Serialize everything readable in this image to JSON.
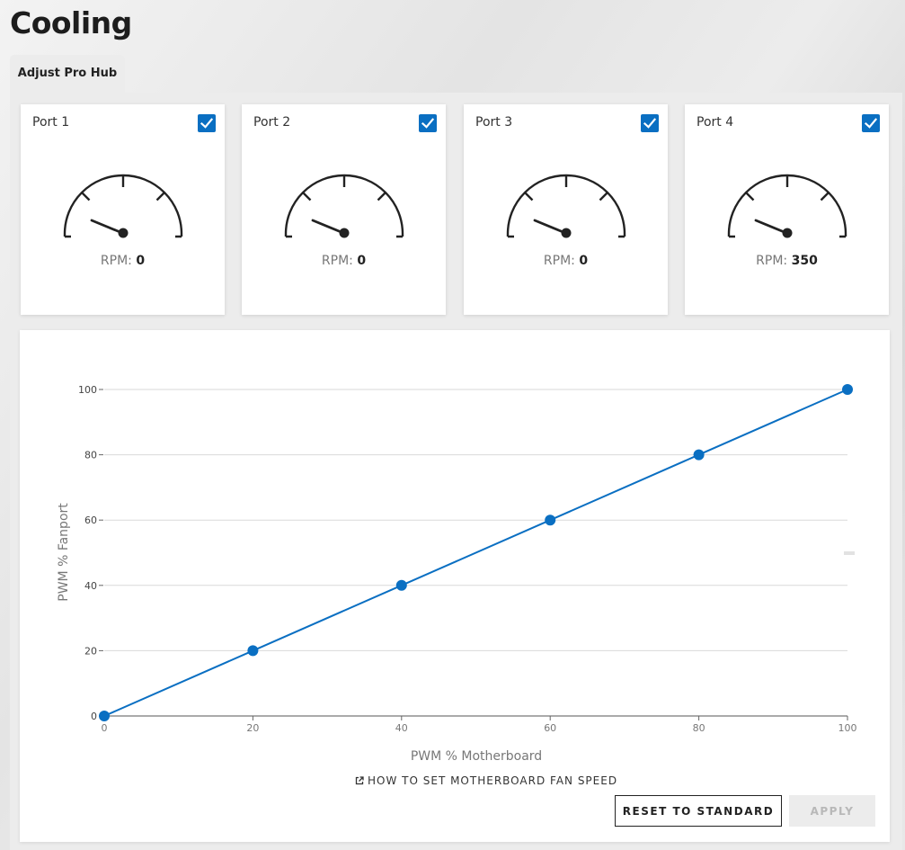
{
  "page": {
    "title": "Cooling"
  },
  "tabs": [
    {
      "label": "Adjust Pro Hub",
      "active": true
    }
  ],
  "ports": [
    {
      "label": "Port 1",
      "checked": true,
      "rpm_label": "RPM:",
      "rpm": "0"
    },
    {
      "label": "Port 2",
      "checked": true,
      "rpm_label": "RPM:",
      "rpm": "0"
    },
    {
      "label": "Port 3",
      "checked": true,
      "rpm_label": "RPM:",
      "rpm": "0"
    },
    {
      "label": "Port 4",
      "checked": true,
      "rpm_label": "RPM:",
      "rpm": "350"
    }
  ],
  "colors": {
    "accent": "#0a6fc2",
    "gauge": "#222222",
    "grid": "#d9d9d9"
  },
  "icons": {
    "checkbox": "check-icon",
    "link": "external-link-icon"
  },
  "chart_data": {
    "type": "line",
    "x": [
      0,
      20,
      40,
      60,
      80,
      100
    ],
    "series": [
      {
        "values": [
          0,
          20,
          40,
          60,
          80,
          100
        ]
      }
    ],
    "xlabel": "PWM % Motherboard",
    "ylabel": "PWM % Fanport",
    "xlim": [
      0,
      100
    ],
    "ylim": [
      0,
      100
    ],
    "xticks": [
      "0",
      "20",
      "40",
      "60",
      "80",
      "100"
    ],
    "yticks": [
      "0",
      "20",
      "40",
      "60",
      "80",
      "100"
    ],
    "grid": "horizontal"
  },
  "actions": {
    "howto_label": "HOW TO SET MOTHERBOARD FAN SPEED",
    "reset_label": "RESET TO STANDARD",
    "apply_label": "APPLY"
  }
}
